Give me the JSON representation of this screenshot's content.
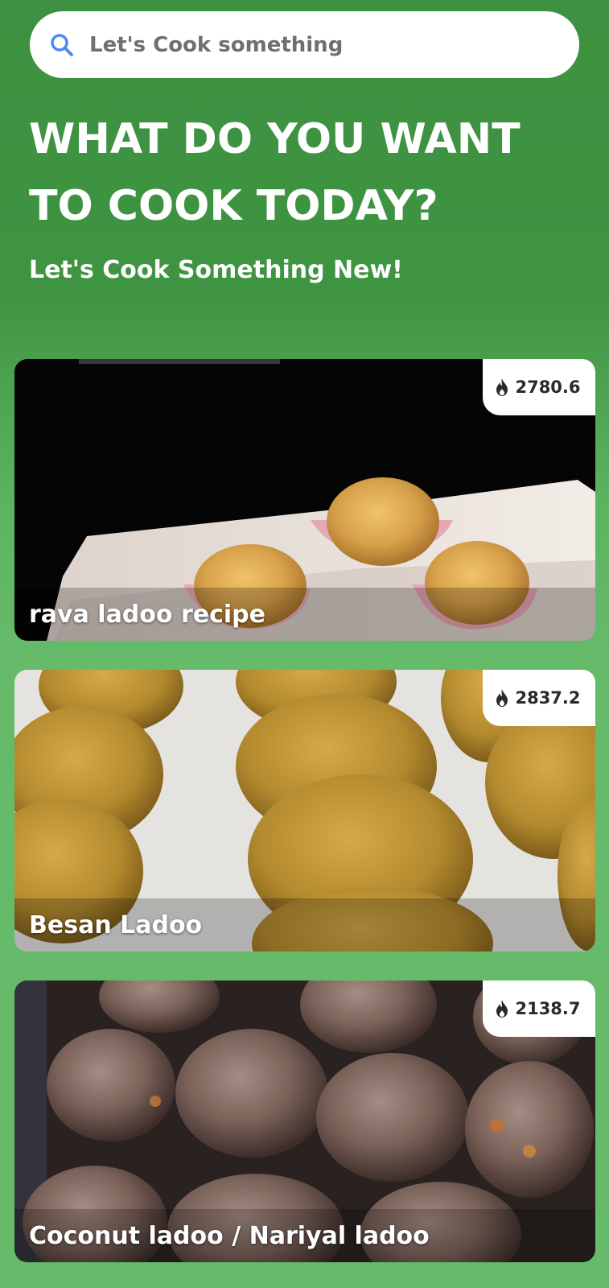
{
  "search": {
    "placeholder": "Let's Cook something",
    "icon": "search-icon"
  },
  "hero": {
    "title": "WHAT DO YOU WANT TO COOK TODAY?",
    "subtitle": "Let's Cook Something New!"
  },
  "recipes": [
    {
      "title": "rava ladoo recipe",
      "calories": "2780.6",
      "badge_icon": "flame-icon"
    },
    {
      "title": "Besan Ladoo",
      "calories": "2837.2",
      "badge_icon": "flame-icon"
    },
    {
      "title": "Coconut ladoo / Nariyal ladoo",
      "calories": "2138.7",
      "badge_icon": "flame-icon"
    }
  ],
  "colors": {
    "background_top": "#3d9140",
    "background_bottom": "#66bb6a",
    "search_icon": "#4a8af4",
    "text_primary": "#ffffff"
  }
}
